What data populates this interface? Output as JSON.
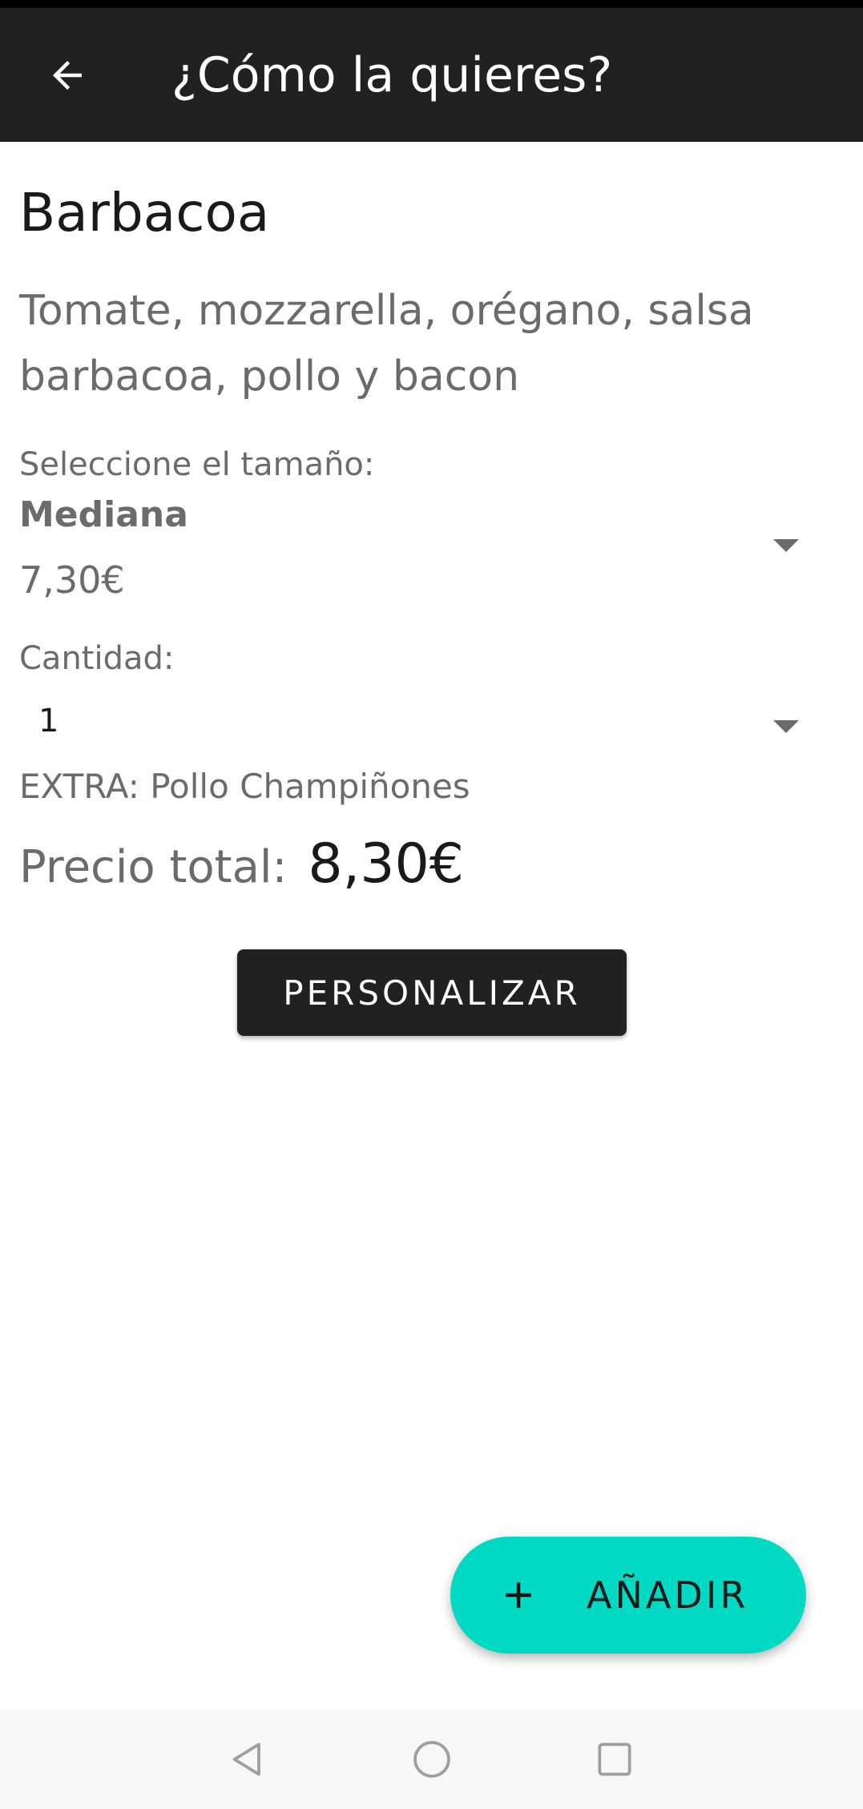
{
  "app_bar": {
    "title": "¿Cómo la quieres?",
    "back_icon": "arrow-back-icon"
  },
  "product": {
    "name": "Barbacoa",
    "description": "Tomate, mozzarella, orégano, salsa barbacoa, pollo y bacon"
  },
  "size": {
    "label": "Seleccione el tamaño:",
    "selected": "Mediana",
    "price": "7,30€"
  },
  "quantity": {
    "label": "Cantidad:",
    "selected": "1"
  },
  "extras": "EXTRA: Pollo Champiñones",
  "total": {
    "label": "Precio total:",
    "value": "8,30€"
  },
  "buttons": {
    "customize": "PERSONALIZAR",
    "add": "AÑADIR",
    "add_icon": "plus-icon"
  },
  "nav": {
    "back_icon": "triangle-back-icon",
    "home_icon": "circle-home-icon",
    "recents_icon": "square-recents-icon"
  },
  "colors": {
    "app_bar": "#212121",
    "accent": "#00d9c3",
    "text_muted": "#6b6b6b"
  }
}
